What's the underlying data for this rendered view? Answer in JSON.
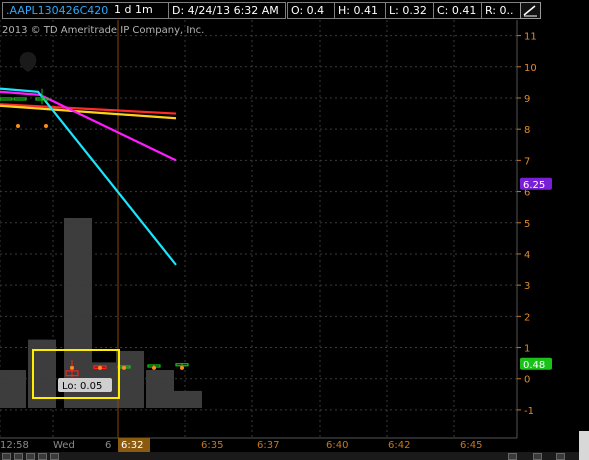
{
  "header": {
    "symbol": ".AAPL130426C420",
    "aggregation": "1 d 1m",
    "date_time": "D: 4/24/13 6:32 AM",
    "open": "O: 0.4",
    "high": "H: 0.41",
    "low": "L: 0.32",
    "close": "C: 0.41",
    "range": "R: 0.."
  },
  "chart_data": {
    "type": "candlestick",
    "copyright": "2013 © TD Ameritrade IP Company, Inc.",
    "price_axis": {
      "ylim": [
        -1.9,
        11.5
      ],
      "ticks": [
        "11",
        "10",
        "9",
        "8",
        "7",
        "6",
        "5",
        "4",
        "3",
        "2",
        "1",
        "0",
        "-1"
      ],
      "tick_values": [
        11,
        10,
        9,
        8,
        7,
        6,
        5,
        4,
        3,
        2,
        1,
        0,
        -1
      ]
    },
    "time_axis": {
      "ticks": [
        "12:58",
        "Wed",
        "6",
        "6:35",
        "6:37",
        "6:40",
        "6:42",
        "6:45"
      ],
      "highlight_label": "6:32"
    },
    "price_badges": [
      {
        "label": "6.25",
        "value": 6.25,
        "color": "#7a1fd8"
      },
      {
        "label": "0.48",
        "value": 0.48,
        "color": "#19c219"
      }
    ],
    "annotation": {
      "label": "Lo: 0.05",
      "value": 0.05
    },
    "moving_averages": [
      {
        "color": "#ff2a2a",
        "points": [
          [
            0,
            8.8
          ],
          [
            176,
            8.5
          ]
        ]
      },
      {
        "color": "#ffd21a",
        "points": [
          [
            0,
            8.75
          ],
          [
            176,
            8.35
          ]
        ]
      },
      {
        "color": "#ff1aff",
        "points": [
          [
            0,
            9.2
          ],
          [
            40,
            9.1
          ],
          [
            176,
            7.0
          ]
        ]
      },
      {
        "color": "#1ae6ff",
        "points": [
          [
            0,
            9.3
          ],
          [
            38,
            9.2
          ],
          [
            176,
            3.65
          ]
        ]
      }
    ],
    "candles": [
      {
        "x": 0,
        "open": 9.0,
        "high": 9.0,
        "low": 9.0,
        "close": 9.0,
        "color": "#19c219"
      },
      {
        "x": 14,
        "open": 9.0,
        "high": 9.0,
        "low": 9.0,
        "close": 9.0,
        "color": "#19c219"
      },
      {
        "x": 36,
        "open": 9.0,
        "high": 9.3,
        "low": 8.8,
        "close": 9.0,
        "color": "#19c219"
      },
      {
        "x": 66,
        "open": 0.25,
        "high": 0.6,
        "low": 0.05,
        "close": 0.1,
        "color": "#ff2020"
      },
      {
        "x": 94,
        "open": 0.41,
        "high": 0.45,
        "low": 0.32,
        "close": 0.33,
        "color": "#ff2020"
      },
      {
        "x": 118,
        "open": 0.4,
        "high": 0.42,
        "low": 0.38,
        "close": 0.41,
        "color": "#19c219"
      },
      {
        "x": 148,
        "open": 0.4,
        "high": 0.46,
        "low": 0.38,
        "close": 0.44,
        "color": "#19c219"
      },
      {
        "x": 176,
        "open": 0.42,
        "high": 0.5,
        "low": 0.38,
        "close": 0.48,
        "color": "#19c219"
      }
    ],
    "orange_dots": [
      {
        "x": 12,
        "value": 8.1
      },
      {
        "x": 40,
        "value": 8.1
      },
      {
        "x": 66,
        "value": 0.35
      },
      {
        "x": 94,
        "value": 0.35
      },
      {
        "x": 118,
        "value": 0.35
      },
      {
        "x": 148,
        "value": 0.35
      },
      {
        "x": 176,
        "value": 0.35
      }
    ],
    "volume": [
      {
        "x": 0,
        "value": 0.2
      },
      {
        "x": 30,
        "value": 0.36
      },
      {
        "x": 66,
        "value": 1.0
      },
      {
        "x": 94,
        "value": 0.24
      },
      {
        "x": 118,
        "value": 0.3
      },
      {
        "x": 148,
        "value": 0.2
      },
      {
        "x": 176,
        "value": 0.09
      }
    ]
  }
}
